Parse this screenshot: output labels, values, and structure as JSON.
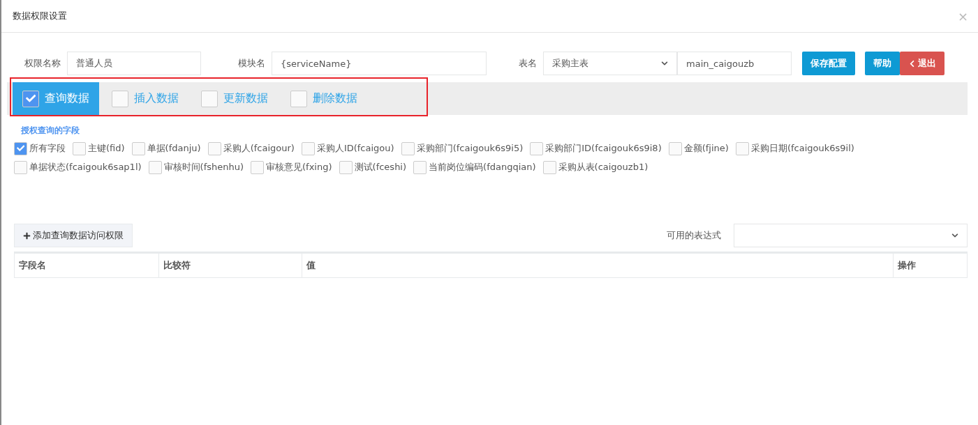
{
  "window": {
    "title": "数据权限设置",
    "close": "×"
  },
  "form": {
    "fields": [
      {
        "kind": "input",
        "label": "权限名称",
        "value": "普通人员"
      },
      {
        "kind": "input",
        "label": "模块名",
        "value": "{serviceName}"
      },
      {
        "kind": "select",
        "label": "表名",
        "value": "采购主表"
      },
      {
        "kind": "input",
        "value": "main_caigouzb"
      }
    ],
    "buttons": [
      {
        "kind": "primary",
        "label": "保存配置"
      },
      {
        "kind": "primary",
        "label": "帮助"
      },
      {
        "kind": "danger",
        "label": "退出"
      }
    ]
  },
  "tabs": [
    {
      "label": "查询数据",
      "selected": true,
      "checked": true
    },
    {
      "label": "插入数据",
      "selected": false,
      "checked": false
    },
    {
      "label": "更新数据",
      "selected": false,
      "checked": false
    },
    {
      "label": "删除数据",
      "selected": false,
      "checked": false
    }
  ],
  "section_title": "授权查询的字段",
  "fields": [
    {
      "label": "所有字段",
      "checked": true
    },
    {
      "label": "主键(fid)",
      "checked": false
    },
    {
      "label": "单据(fdanju)",
      "checked": false
    },
    {
      "label": "采购人(fcaigour)",
      "checked": false
    },
    {
      "label": "采购人ID(fcaigou)",
      "checked": false
    },
    {
      "label": "采购部门(fcaigouk6s9i5)",
      "checked": false
    },
    {
      "label": "采购部门ID(fcaigouk6s9i8)",
      "checked": false
    },
    {
      "label": "金额(fjine)",
      "checked": false
    },
    {
      "label": "采购日期(fcaigouk6s9il)",
      "checked": false
    },
    {
      "label": "单据状态(fcaigouk6sap1l)",
      "checked": false
    },
    {
      "label": "审核时间(fshenhu)",
      "checked": false
    },
    {
      "label": "审核意见(fxing)",
      "checked": false
    },
    {
      "label": "测试(fceshi)",
      "checked": false
    },
    {
      "label": "当前岗位编码(fdangqian)",
      "checked": false
    },
    {
      "label": "采购从表(caigouzb1)",
      "checked": false
    }
  ],
  "add_button": "添加查询数据访问权限",
  "expression": {
    "label": "可用的表达式"
  },
  "table": {
    "columns": [
      "字段名",
      "比较符",
      "值",
      "操作"
    ]
  }
}
